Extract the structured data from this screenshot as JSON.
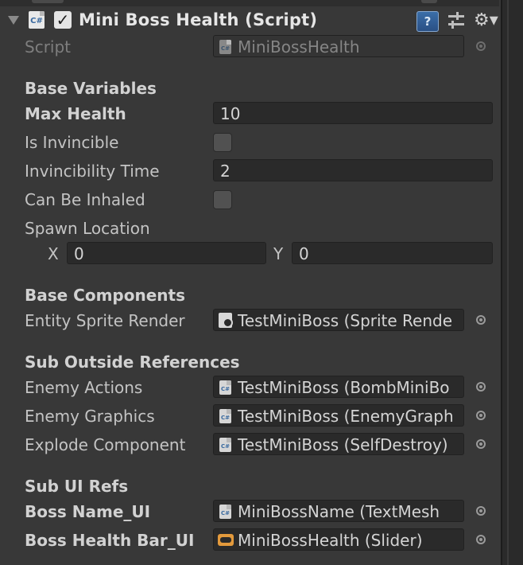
{
  "component": {
    "title": "Mini Boss Health (Script)",
    "enabled": true,
    "icons": [
      "foldout-arrow-icon",
      "csharp-script-icon",
      "help-icon",
      "presets-icon",
      "gear-icon"
    ]
  },
  "script_row": {
    "label": "Script",
    "value": "MiniBossHealth"
  },
  "sections": {
    "base_variables": "Base Variables",
    "base_components": "Base Components",
    "sub_outside_references": "Sub Outside References",
    "sub_ui_refs": "Sub UI Refs"
  },
  "fields": {
    "max_health": {
      "label": "Max Health",
      "value": "10"
    },
    "is_invincible": {
      "label": "Is Invincible",
      "checked": false
    },
    "invincibility_time": {
      "label": "Invincibility Time",
      "value": "2"
    },
    "can_be_inhaled": {
      "label": "Can Be Inhaled",
      "checked": false
    },
    "spawn_location": {
      "label": "Spawn Location",
      "x_label": "X",
      "x": "0",
      "y_label": "Y",
      "y": "0"
    },
    "entity_sprite_render": {
      "label": "Entity Sprite Render",
      "value": "TestMiniBoss (Sprite Rende"
    },
    "enemy_actions": {
      "label": "Enemy Actions",
      "value": "TestMiniBoss (BombMiniBo"
    },
    "enemy_graphics": {
      "label": "Enemy Graphics",
      "value": "TestMiniBoss (EnemyGraph"
    },
    "explode_component": {
      "label": "Explode Component",
      "value": "TestMiniBoss (SelfDestroy)"
    },
    "boss_name_ui": {
      "label": "Boss Name_UI",
      "value": "MiniBossName (TextMesh"
    },
    "boss_health_bar_ui": {
      "label": "Boss Health Bar_UI",
      "value": "MiniBossHealth (Slider)"
    }
  },
  "colors": {
    "panel_bg": "#383838",
    "field_bg": "#2a2a2a",
    "help_icon_blue": "#3b6ea8",
    "slider_icon_orange": "#e39a3c"
  }
}
